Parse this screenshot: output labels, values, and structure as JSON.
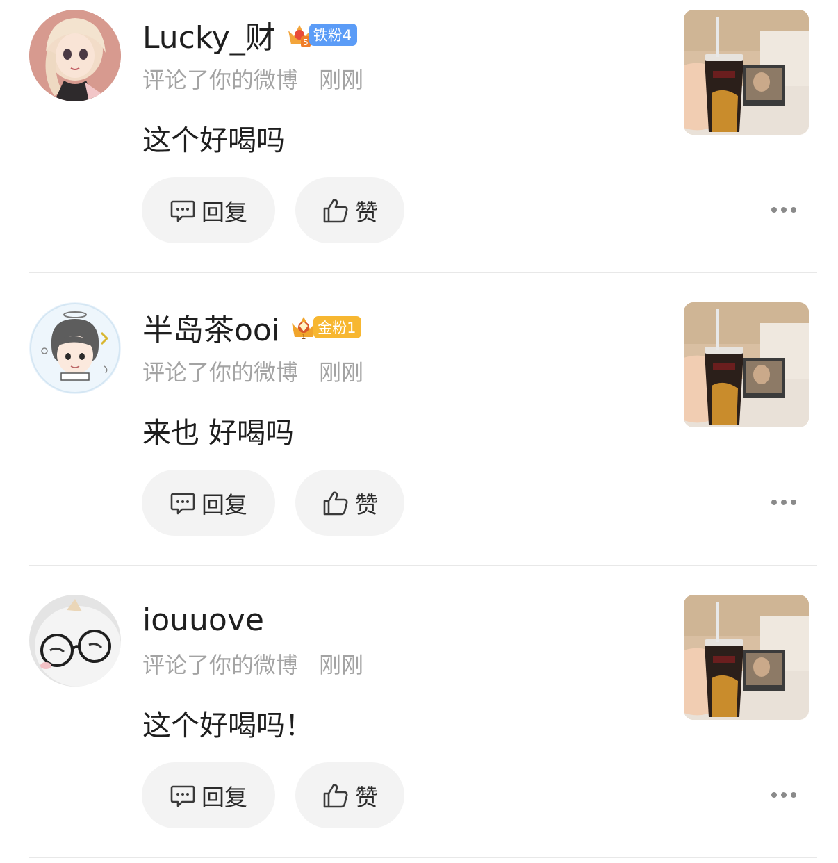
{
  "comments": [
    {
      "username": "Lucky_财",
      "badge": {
        "label": "铁粉4",
        "level": "5",
        "color": "#5b9cf7"
      },
      "action": "评论了你的微博",
      "time": "刚刚",
      "text": "这个好喝吗",
      "reply_label": "回复",
      "like_label": "赞"
    },
    {
      "username": "半岛茶ooi",
      "badge": {
        "label": "金粉1",
        "level": "1",
        "color": "#f7b731"
      },
      "action": "评论了你的微博",
      "time": "刚刚",
      "text": "来也 好喝吗",
      "reply_label": "回复",
      "like_label": "赞"
    },
    {
      "username": "iouuove",
      "action": "评论了你的微博",
      "time": "刚刚",
      "text": "这个好喝吗！",
      "reply_label": "回复",
      "like_label": "赞"
    }
  ],
  "icons": {
    "reply": "comment-bubble-icon",
    "like": "thumbs-up-icon",
    "more": "more-dots-icon",
    "badge_crown": "crown-icon"
  },
  "colors": {
    "pill_bg": "#f3f3f3",
    "meta_text": "#a3a3a3",
    "primary_text": "#1f1f1f"
  }
}
